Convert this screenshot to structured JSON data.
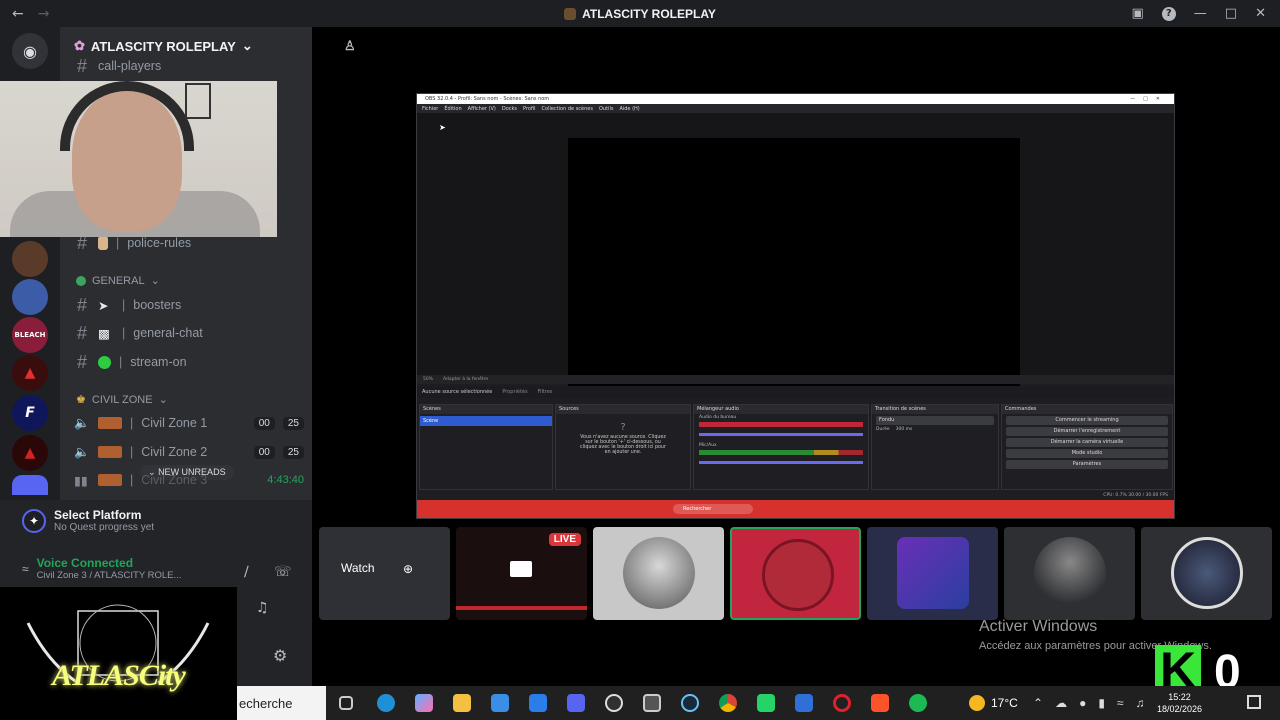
{
  "window": {
    "title": "ATLASCITY ROLEPLAY"
  },
  "server": {
    "name": "ATLASCITY ROLEPLAY"
  },
  "channels": {
    "top_partial": "call-players",
    "police_rules": "police-rules",
    "category_general": "GENERAL",
    "boosters": "boosters",
    "general_chat": "general-chat",
    "stream_on": "stream-on",
    "category_civil": "CIVIL ZONE",
    "civil1": {
      "label": "Civil Zone 1",
      "count": "00",
      "limit": "25"
    },
    "civil2": {
      "label": "Civil Zone 2",
      "count": "00",
      "limit": "25"
    },
    "civil3": {
      "label": "Civil Zone 3",
      "time": "4:43:40"
    },
    "new_unreads": "NEW UNREADS"
  },
  "quest": {
    "title": "Select Platform",
    "subtitle": "No Quest progress yet"
  },
  "voice": {
    "status": "Voice Connected",
    "detail": "Civil Zone 3 / ATLASCITY ROLE..."
  },
  "logo": {
    "text": "ATLASCity"
  },
  "obs": {
    "title": "OBS 32.0.4 - Profil: Sans nom - Scènes: Sans nom",
    "menu": [
      "Fichier",
      "Édition",
      "Afficher (V)",
      "Docks",
      "Profil",
      "Collection de scènes",
      "Outils",
      "Aide (H)"
    ],
    "zoom": "50%",
    "fit": "Adapter à la fenêtre",
    "no_source": "Aucune source sélectionnée",
    "properties": "Propriétés",
    "filters": "Filtres",
    "docks": {
      "scenes": "Scènes",
      "scene_item": "Scène",
      "sources": "Sources",
      "sources_empty": "Vous n'avez aucune source. Cliquez sur le bouton '+' ci-dessous, ou cliquez avec le bouton droit ici pour en ajouter une.",
      "mixer": "Mélangeur audio",
      "audio_desktop": "Audio du bureau",
      "mic": "Mic/Aux",
      "transitions": "Transition de scènes",
      "fade": "Fondu",
      "duration_label": "Durée",
      "duration": "300 ms",
      "controls": "Commandes",
      "btn_stream": "Commencer le streaming",
      "btn_record": "Démarrer l'enregistrement",
      "btn_vcam": "Démarrer la caméra virtuelle",
      "btn_studio": "Mode studio",
      "btn_settings": "Paramètres"
    },
    "status": "CPU: 0.7%   30.00 / 30.00 FPS",
    "taskbar_search": "Rechercher"
  },
  "tiles": {
    "watch": "Watch",
    "live": "LIVE"
  },
  "activate": {
    "title": "Activer Windows",
    "subtitle": "Accédez aux paramètres pour activer Windows."
  },
  "overlay": {
    "k": "K",
    "zero": "0"
  },
  "taskbar": {
    "search": "echerche",
    "weather": "17°C",
    "time": "15:22",
    "date": "18/02/2026"
  },
  "colors": {
    "discord_dark": "#1e1f22",
    "channel_bg": "#2b2d31",
    "obs_red": "#d6312c",
    "live_red": "#da373c",
    "highlight_tile": "#c2253e",
    "k_green": "#39e639"
  }
}
